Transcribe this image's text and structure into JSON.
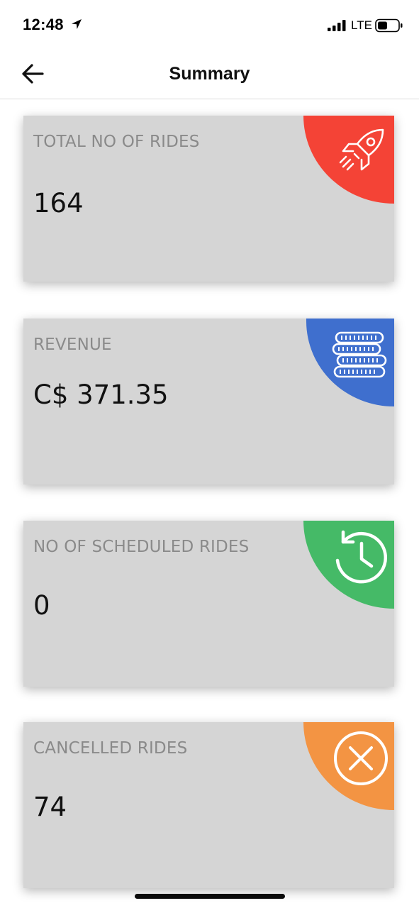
{
  "status_bar": {
    "time": "12:48",
    "network": "LTE",
    "icons": [
      "location-arrow-icon",
      "signal-bars-icon",
      "battery-icon"
    ]
  },
  "nav": {
    "title": "Summary",
    "back_icon": "arrow-left-icon"
  },
  "cards": [
    {
      "label": "TOTAL NO OF RIDES",
      "value": "164",
      "icon": "rocket-icon",
      "color": "#F44336"
    },
    {
      "label": "REVENUE",
      "value": "C$ 371.35",
      "icon": "coins-stack-icon",
      "color": "#3F6FCE"
    },
    {
      "label": "NO OF SCHEDULED RIDES",
      "value": "0",
      "icon": "history-clock-icon",
      "color": "#45BA67"
    },
    {
      "label": "CANCELLED RIDES",
      "value": "74",
      "icon": "close-circle-icon",
      "color": "#F39443"
    }
  ]
}
